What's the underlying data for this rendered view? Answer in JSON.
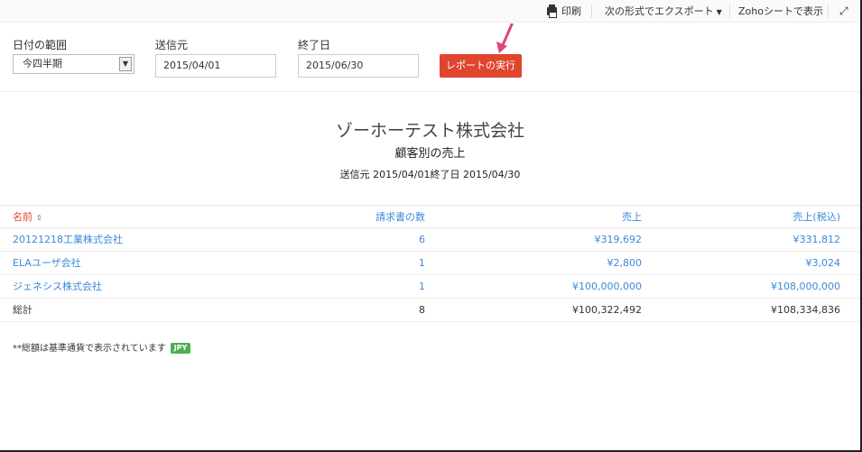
{
  "toolbar": {
    "print": "印刷",
    "export": "次の形式でエクスポート",
    "zoho_sheet": "Zohoシートで表示"
  },
  "filters": {
    "date_range_label": "日付の範囲",
    "date_range_value": "今四半期",
    "from_label": "送信元",
    "from_value": "2015/04/01",
    "to_label": "終了日",
    "to_value": "2015/06/30",
    "run_button": "レポートの実行"
  },
  "report": {
    "company": "ゾーホーテスト株式会社",
    "title": "顧客別の売上",
    "range": "送信元 2015/04/01終了日 2015/04/30"
  },
  "table": {
    "headers": [
      "名前",
      "請求書の数",
      "売上",
      "売上(税込)"
    ],
    "rows": [
      {
        "name": "20121218工業株式会社",
        "count": "6",
        "sales": "¥319,692",
        "sales_tax": "¥331,812"
      },
      {
        "name": "ELAユーザ会社",
        "count": "1",
        "sales": "¥2,800",
        "sales_tax": "¥3,024"
      },
      {
        "name": "ジェネシス株式会社",
        "count": "1",
        "sales": "¥100,000,000",
        "sales_tax": "¥108,000,000"
      }
    ],
    "total": {
      "name": "総計",
      "count": "8",
      "sales": "¥100,322,492",
      "sales_tax": "¥108,334,836"
    }
  },
  "footnote": {
    "text": "**総額は基準通貨で表示されています",
    "currency": "JPY"
  },
  "colors": {
    "accent": "#e0452e",
    "link": "#3b8ad8",
    "badge": "#4caf50"
  }
}
